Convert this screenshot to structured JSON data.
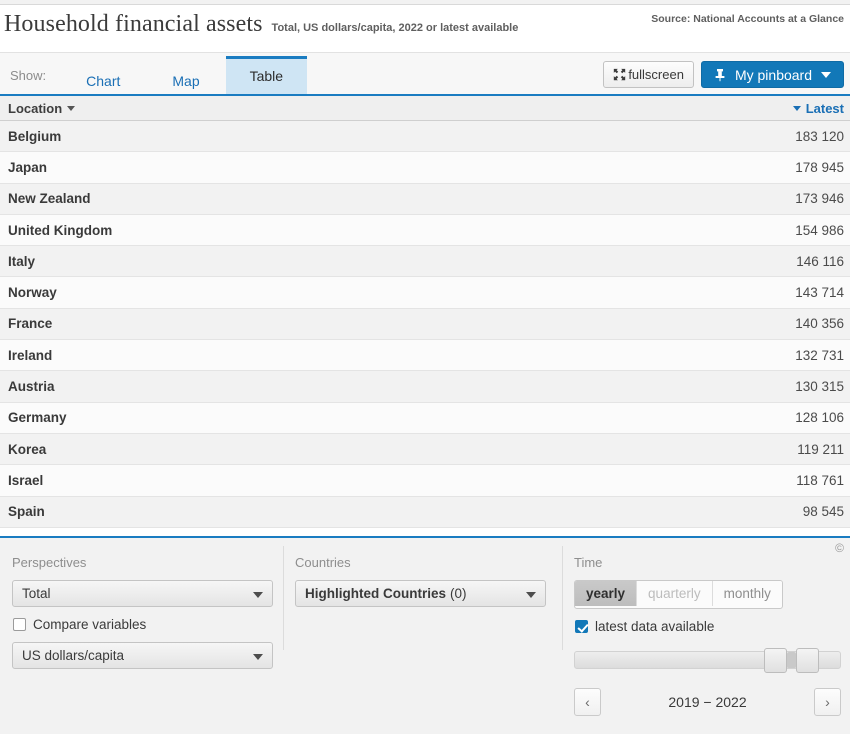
{
  "header": {
    "title": "Household financial assets",
    "subtitle": "Total, US dollars/capita, 2022 or latest available",
    "source": "Source: National Accounts at a Glance"
  },
  "toolbar": {
    "show_label": "Show:",
    "tabs": [
      {
        "label": "Chart",
        "selected": false
      },
      {
        "label": "Map",
        "selected": false
      },
      {
        "label": "Table",
        "selected": true
      }
    ],
    "fullscreen_label": "fullscreen",
    "fullscreen_icon": "expand-arrows-icon",
    "pinboard_label": "My pinboard",
    "pinboard_icon": "pin-icon",
    "pinboard_caret": "caret-down-icon",
    "accent_blue": "#1a7cc1",
    "pinboard_bg": "#1278b8"
  },
  "table": {
    "columns": [
      {
        "key": "location",
        "label": "Location",
        "sort_icon": "caret-down-icon"
      },
      {
        "key": "latest",
        "label": "Latest",
        "sort_icon": "caret-down-icon"
      }
    ],
    "rows": [
      {
        "location": "Belgium",
        "latest": "183 120"
      },
      {
        "location": "Japan",
        "latest": "178 945"
      },
      {
        "location": "New Zealand",
        "latest": "173 946"
      },
      {
        "location": "United Kingdom",
        "latest": "154 986"
      },
      {
        "location": "Italy",
        "latest": "146 116"
      },
      {
        "location": "Norway",
        "latest": "143 714"
      },
      {
        "location": "France",
        "latest": "140 356"
      },
      {
        "location": "Ireland",
        "latest": "132 731"
      },
      {
        "location": "Austria",
        "latest": "130 315"
      },
      {
        "location": "Germany",
        "latest": "128 106"
      },
      {
        "location": "Korea",
        "latest": "119 211"
      },
      {
        "location": "Israel",
        "latest": "118 761"
      },
      {
        "location": "Spain",
        "latest": "98 545"
      }
    ]
  },
  "controls": {
    "perspectives": {
      "label": "Perspectives",
      "measure_value": "Total",
      "compare_label": "Compare variables",
      "compare_checked": false,
      "unit_value": "US dollars/capita",
      "caret_icon": "caret-down-icon"
    },
    "countries": {
      "label": "Countries",
      "selected_bold": "Highlighted Countries",
      "selected_count": "(0)",
      "caret_icon": "caret-down-icon"
    },
    "time": {
      "label": "Time",
      "frequencies": [
        {
          "label": "yearly",
          "state": "active"
        },
        {
          "label": "quarterly",
          "state": "disabled"
        },
        {
          "label": "monthly",
          "state": "normal"
        }
      ],
      "latest_label": "latest data available",
      "latest_checked": true,
      "slider": {
        "handle_left_pct": 78,
        "handle_right_pct": 91
      },
      "prev_icon": "chevron-left-icon",
      "next_icon": "chevron-right-icon",
      "range_label": "2019 − 2022"
    },
    "copyright": "©"
  }
}
